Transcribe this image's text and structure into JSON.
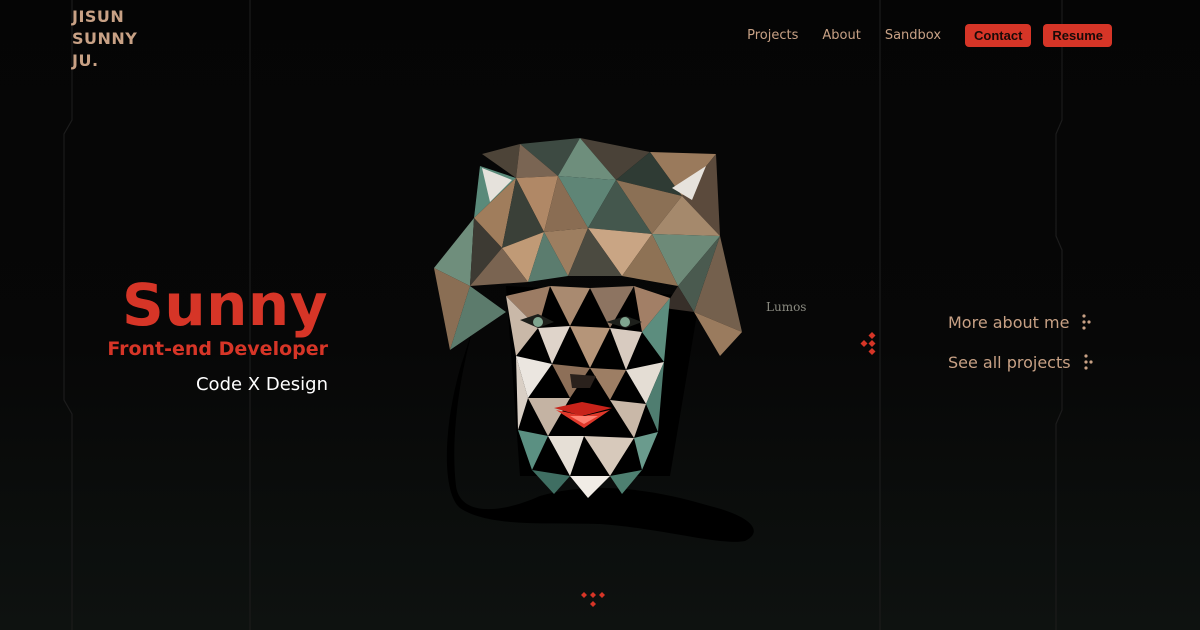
{
  "logo": {
    "lines": [
      "JISUN",
      "SUNNY",
      "JU."
    ]
  },
  "nav": {
    "links": [
      "Projects",
      "About",
      "Sandbox"
    ],
    "contact_label": "Contact",
    "resume_label": "Resume"
  },
  "hero": {
    "name": "Sunny",
    "role": "Front-end Developer",
    "tagline": "Code X Design"
  },
  "portrait": {
    "caption": "Lumos"
  },
  "side_links": {
    "about": "More about me",
    "projects": "See all projects"
  },
  "icons": {
    "dots": "dots-menu-icon",
    "diamonds": "diamond-cluster-icon",
    "scroll": "scroll-down-icon"
  },
  "colors": {
    "accent": "#d63527",
    "tan": "#c8a185",
    "background": "#050505"
  }
}
